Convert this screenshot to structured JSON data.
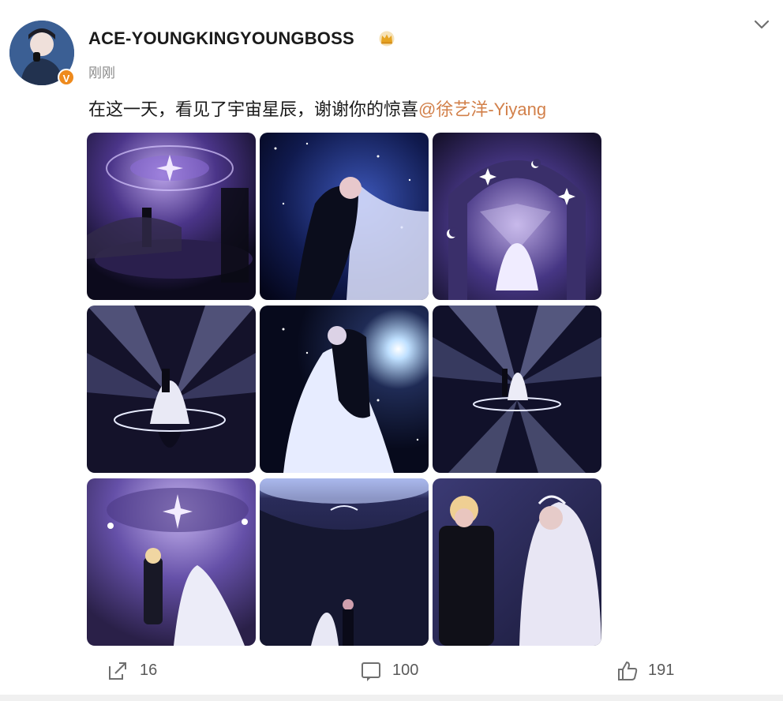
{
  "post": {
    "username": "ACE-YOUNGKINGYOUNGBOSS",
    "verified_badge": "V",
    "timestamp": "刚刚",
    "text_main": "在这一天，看见了宇宙星辰，谢谢你的惊喜",
    "text_mention": "@徐艺洋-Yiyang"
  },
  "photos": [
    {
      "name": "photo-1",
      "desc": "purple galaxy stage"
    },
    {
      "name": "photo-2",
      "desc": "couple kiss under starry sky"
    },
    {
      "name": "photo-3",
      "desc": "arch with moons and stars"
    },
    {
      "name": "photo-4",
      "desc": "light beams and ring"
    },
    {
      "name": "photo-5",
      "desc": "couple kiss with bright star"
    },
    {
      "name": "photo-6",
      "desc": "light beams reflection"
    },
    {
      "name": "photo-7",
      "desc": "couple under galaxy ceiling"
    },
    {
      "name": "photo-8",
      "desc": "dark dome hall"
    },
    {
      "name": "photo-9",
      "desc": "couple close-up"
    }
  ],
  "actions": {
    "share_count": "16",
    "comment_count": "100",
    "like_count": "191"
  },
  "icons": {
    "crown": "crown-icon",
    "chevron": "chevron-down-icon",
    "share": "share-icon",
    "comment": "comment-icon",
    "like": "thumbs-up-icon"
  },
  "colors": {
    "mention": "#d2804a",
    "verified": "#ee8a1d"
  }
}
